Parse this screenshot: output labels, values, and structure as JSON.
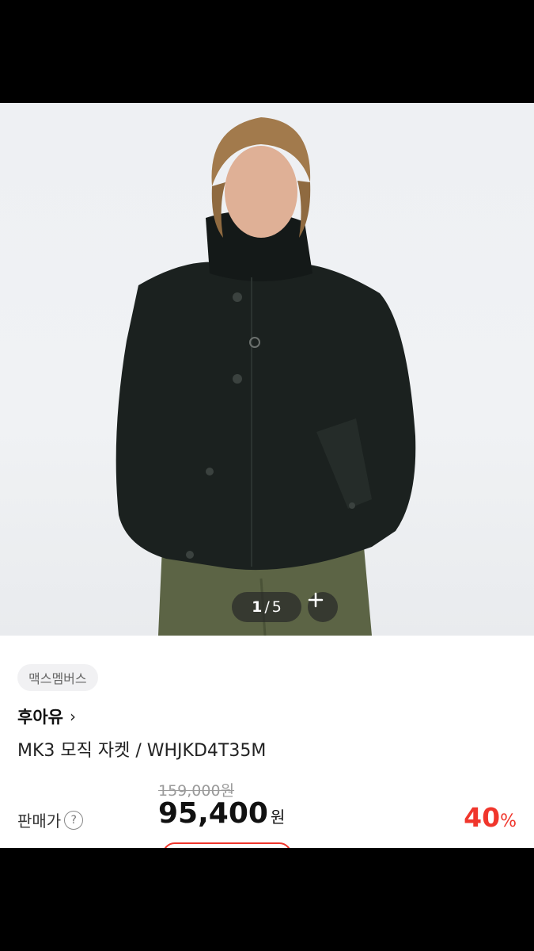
{
  "gallery": {
    "current": "1",
    "separator": "/",
    "total": "5",
    "expand_icon": "plus-icon"
  },
  "badge": {
    "label": "맥스멤버스"
  },
  "brand": {
    "name": "후아유",
    "chevron": "›"
  },
  "product": {
    "name": "MK3 모직 자켓 / WHJKD4T35M"
  },
  "pricing": {
    "original_price": "159,000원",
    "label": "판매가",
    "help_icon": "?",
    "sale_price": "95,400",
    "currency": "원",
    "discount": "40",
    "discount_unit": "%"
  },
  "colors": {
    "accent_red": "#f0362c",
    "jacket": "#1b211f",
    "pants": "#5c6445"
  }
}
